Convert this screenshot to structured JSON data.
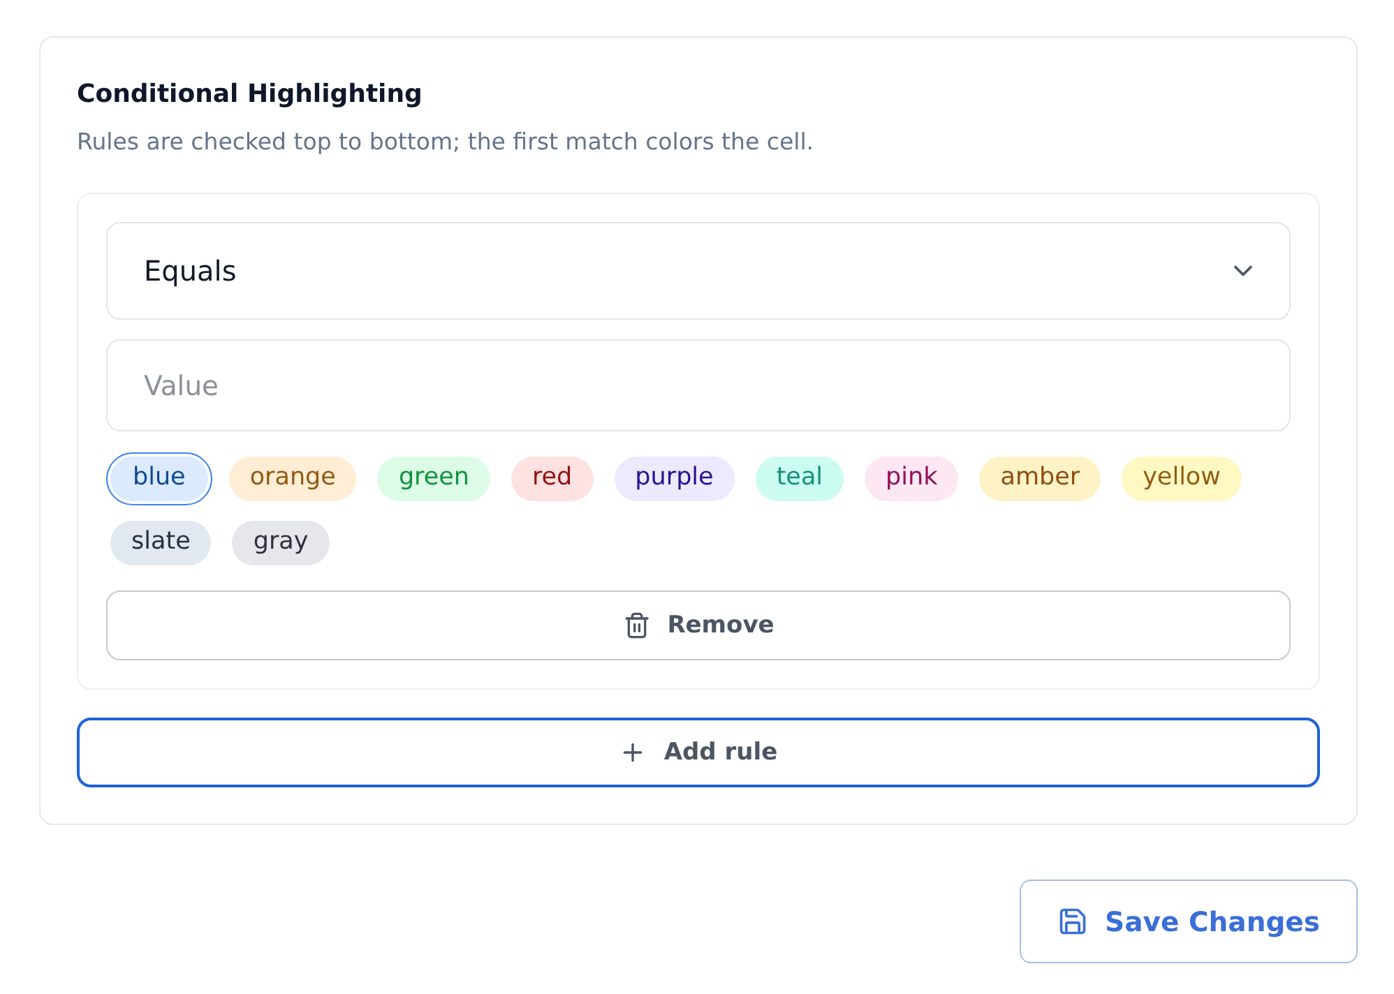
{
  "panel": {
    "title": "Conditional Highlighting",
    "description": "Rules are checked top to bottom; the first match colors the cell."
  },
  "rules": [
    {
      "operator": "Equals",
      "value": {
        "placeholder": "Value"
      },
      "colors": [
        {
          "label": "blue",
          "color": "#dbeafe",
          "selected": true
        },
        {
          "label": "orange",
          "color": "#ffedd5",
          "selected": false
        },
        {
          "label": "green",
          "color": "#dcfce7",
          "selected": false
        },
        {
          "label": "red",
          "color": "#fee2e2",
          "selected": false
        },
        {
          "label": "purple",
          "color": "#ede9fe",
          "selected": false
        },
        {
          "label": "teal",
          "color": "#ccfbf1",
          "selected": false
        },
        {
          "label": "pink",
          "color": "#fce7f3",
          "selected": false
        },
        {
          "label": "amber",
          "color": "#fef3c7",
          "selected": false
        },
        {
          "label": "yellow",
          "color": "#fef9c3",
          "selected": false
        },
        {
          "label": "slate",
          "color": "#e2e8f0",
          "selected": false
        },
        {
          "label": "gray",
          "color": "#e5e7eb",
          "selected": false
        }
      ],
      "remove_button": "Remove"
    }
  ],
  "add_rule_button": {
    "label": "Add rule",
    "focused": true
  },
  "save_button": "Save Changes"
}
